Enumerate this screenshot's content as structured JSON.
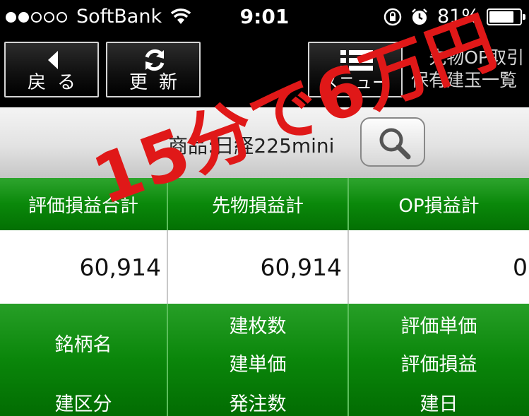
{
  "status_bar": {
    "carrier": "SoftBank",
    "time": "9:01",
    "battery": "81%",
    "battery_level": 0.81,
    "icons": [
      "signal-dots",
      "wifi-icon",
      "rotation-lock-icon",
      "alarm-icon",
      "battery-icon"
    ]
  },
  "toolbar": {
    "back_label": "戻る",
    "refresh_label": "更新",
    "menu_label": "メニュー",
    "title_line1": "先物OP取引",
    "title_line2": "保有建玉一覧",
    "icons": [
      "back-arrow-icon",
      "refresh-icon",
      "menu-list-icon"
    ]
  },
  "product": {
    "label": "商品:日経225mini",
    "icons": [
      "search-icon"
    ]
  },
  "summary": {
    "headers": [
      "評価損益合計",
      "先物損益計",
      "OP損益計"
    ],
    "values": [
      "60,914",
      "60,914",
      "0"
    ]
  },
  "detail_header": {
    "col1": [
      "銘柄名",
      "建区分"
    ],
    "col2": [
      "建枚数",
      "建単価",
      "発注数"
    ],
    "col3": [
      "評価単価",
      "評価損益",
      "建日"
    ]
  },
  "overlay": {
    "text": "15分で6万円",
    "color": "#e01818"
  },
  "colors": {
    "header_green": "#0a880a",
    "toolbar_black": "#000000"
  }
}
